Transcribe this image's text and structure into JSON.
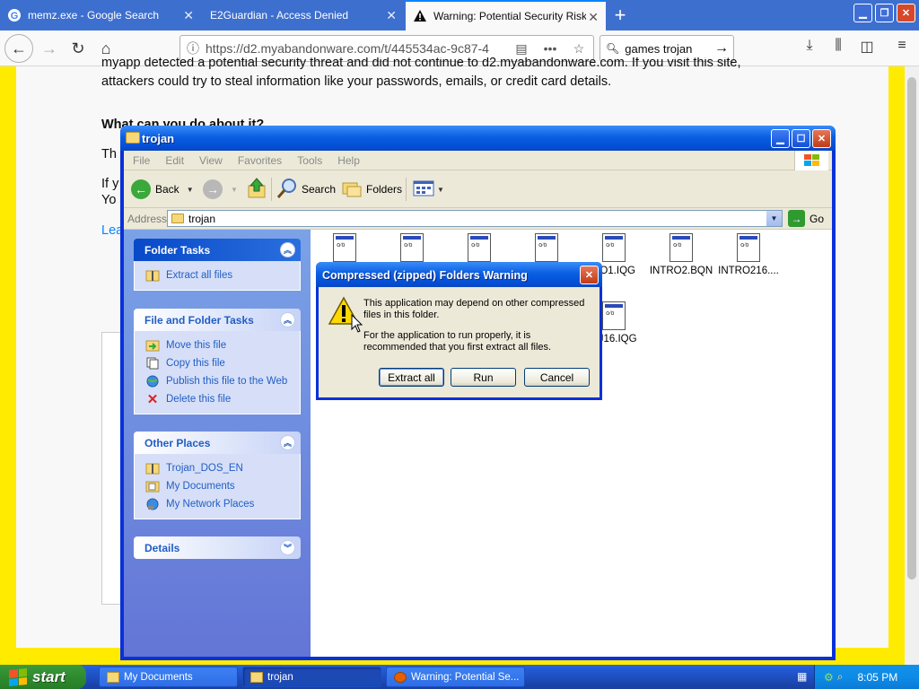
{
  "browser": {
    "tabs": [
      {
        "title": "memz.exe - Google Search"
      },
      {
        "title": "E2Guardian - Access Denied"
      },
      {
        "title": "Warning: Potential Security Risk A"
      }
    ],
    "url": "https://d2.myabandonware.com/t/445534ac-9c87-4",
    "search_query": "games trojan"
  },
  "webpage": {
    "line1": "myapp detected a potential security threat and did not continue to d2.myabandonware.com. If you visit this site,",
    "line2": "attackers could try to steal information like your passwords, emails, or credit card details.",
    "heading": "What can you do about it?",
    "frag1": "Th",
    "frag2": "If y",
    "frag3": "Yo",
    "frag4": "Lea"
  },
  "explorer": {
    "title": "trojan",
    "menu": [
      "File",
      "Edit",
      "View",
      "Favorites",
      "Tools",
      "Help"
    ],
    "toolbar": {
      "back": "Back",
      "search": "Search",
      "folders": "Folders"
    },
    "address_label": "Address",
    "address_value": "trojan",
    "go_label": "Go"
  },
  "task_pane": {
    "folder_tasks": {
      "title": "Folder Tasks",
      "items": [
        "Extract all files"
      ]
    },
    "file_tasks": {
      "title": "File and Folder Tasks",
      "items": [
        "Move this file",
        "Copy this file",
        "Publish this file to the Web",
        "Delete this file"
      ]
    },
    "other_places": {
      "title": "Other Places",
      "items": [
        "Trojan_DOS_EN",
        "My Documents",
        "My Network Places"
      ]
    },
    "details": {
      "title": "Details"
    }
  },
  "files": [
    "RO1.IQG",
    "INTRO2.BQN",
    "INTRO216....",
    "RJ16.IQG"
  ],
  "dialog": {
    "title": "Compressed (zipped) Folders Warning",
    "message1": "This application may depend on other compressed files in this folder.",
    "message2": "For the application to run properly, it is recommended that you first extract all files.",
    "buttons": [
      "Extract all",
      "Run",
      "Cancel"
    ]
  },
  "taskbar": {
    "start_label": "start",
    "tasks": [
      "My Documents",
      "trojan",
      "Warning: Potential Se..."
    ],
    "clock": "8:05 PM"
  }
}
